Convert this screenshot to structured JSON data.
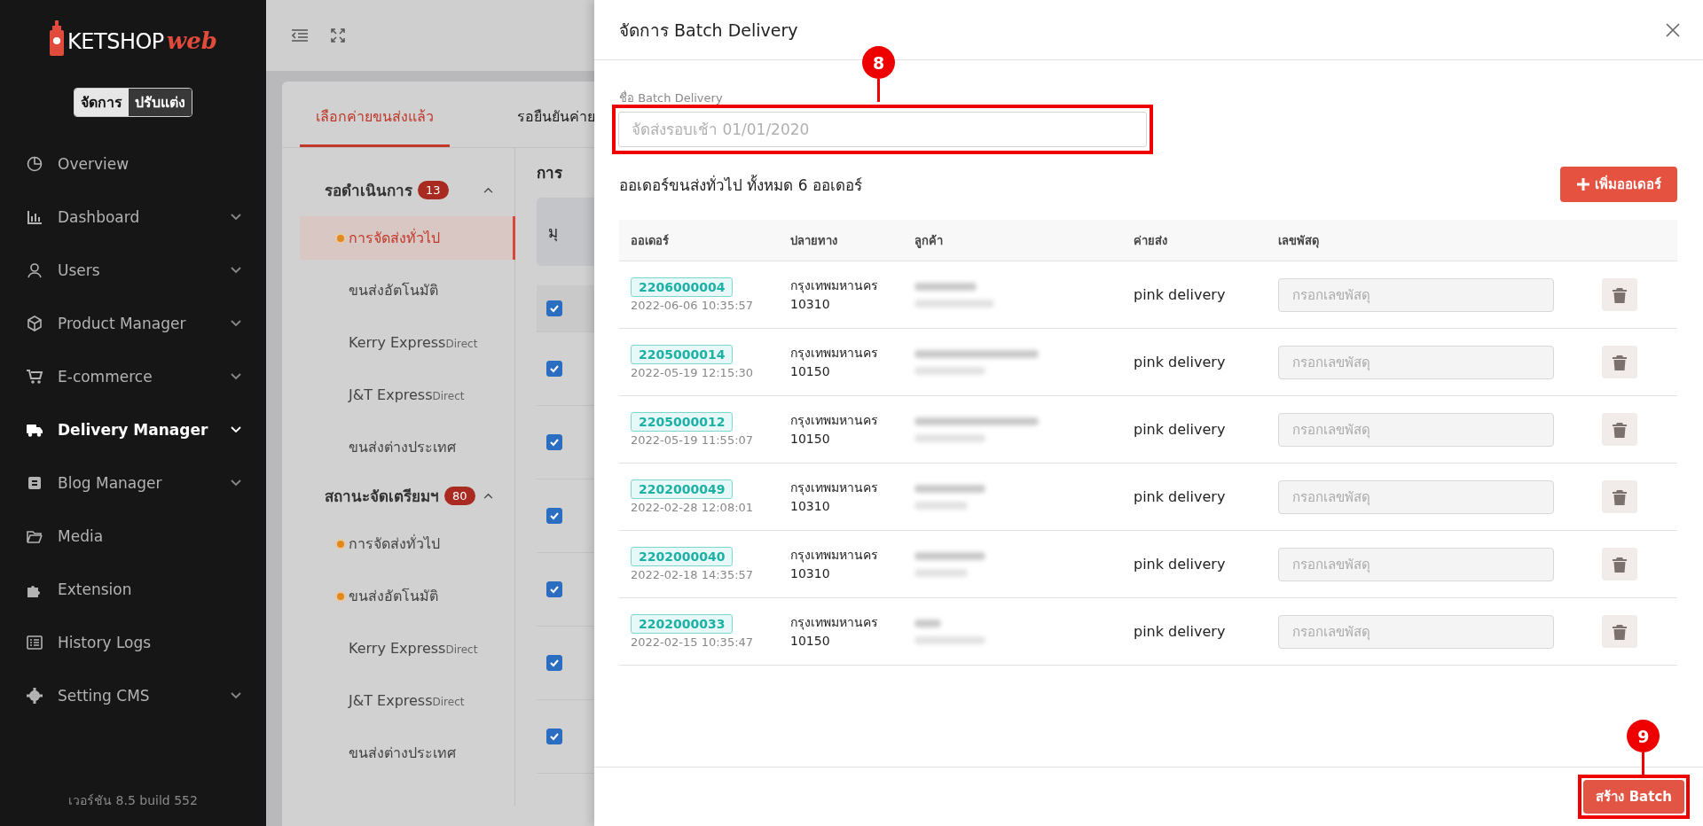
{
  "sidebar": {
    "logo": {
      "main": "KETSHOP",
      "accent": "web"
    },
    "mode_toggle": [
      {
        "label": "จัดการ",
        "selected": true
      },
      {
        "label": "ปรับแต่ง",
        "selected": false
      }
    ],
    "items": [
      {
        "label": "Overview",
        "expandable": false,
        "selected": false
      },
      {
        "label": "Dashboard",
        "expandable": true,
        "selected": false
      },
      {
        "label": "Users",
        "expandable": true,
        "selected": false
      },
      {
        "label": "Product Manager",
        "expandable": true,
        "selected": false
      },
      {
        "label": "E-commerce",
        "expandable": true,
        "selected": false
      },
      {
        "label": "Delivery Manager",
        "expandable": true,
        "selected": true
      },
      {
        "label": "Blog Manager",
        "expandable": true,
        "selected": false
      },
      {
        "label": "Media",
        "expandable": false,
        "selected": false
      },
      {
        "label": "Extension",
        "expandable": false,
        "selected": false
      },
      {
        "label": "History Logs",
        "expandable": false,
        "selected": false
      },
      {
        "label": "Setting CMS",
        "expandable": true,
        "selected": false
      }
    ],
    "version": "เวอร์ชัน 8.5 build 552"
  },
  "main": {
    "tabs": [
      {
        "label": "เลือกค่ายขนส่งแล้ว",
        "selected": true
      },
      {
        "label": "รอยืนยันค่าย",
        "selected": false
      }
    ],
    "groups": [
      {
        "title": "รอดำเนินการ",
        "count": "13",
        "expanded": true,
        "items": [
          {
            "label": "การจัดส่งทั่วไป",
            "dot": true,
            "selected": true
          },
          {
            "label": "ขนส่งอัตโนมัติ",
            "dot": false,
            "selected": false
          },
          {
            "label": "Kerry Express",
            "note": "Direct",
            "dot": false,
            "selected": false
          },
          {
            "label": "J&T Express",
            "note": "Direct",
            "dot": false,
            "selected": false
          },
          {
            "label": "ขนส่งต่างประเทศ",
            "dot": false,
            "selected": false
          }
        ]
      },
      {
        "title": "สถานะจัดเตรียมฯ",
        "count": "80",
        "expanded": true,
        "items": [
          {
            "label": "การจัดส่งทั่วไป",
            "dot": true,
            "selected": false
          },
          {
            "label": "ขนส่งอัตโนมัติ",
            "dot": true,
            "selected": false
          },
          {
            "label": "Kerry Express",
            "note": "Direct",
            "dot": false,
            "selected": false
          },
          {
            "label": "J&T Express",
            "note": "Direct",
            "dot": false,
            "selected": false
          },
          {
            "label": "ขนส่งต่างประเทศ",
            "dot": false,
            "selected": false
          }
        ]
      }
    ],
    "panel": {
      "heading": "การ",
      "filter": "มุ",
      "rows": [
        {
          "checked": true
        },
        {
          "checked": true
        },
        {
          "checked": true
        },
        {
          "checked": true
        },
        {
          "checked": true
        },
        {
          "checked": true
        },
        {
          "checked": true
        }
      ]
    }
  },
  "drawer": {
    "title": "จัดการ Batch Delivery",
    "name_field": {
      "label": "ชื่อ Batch Delivery",
      "placeholder": "จัดส่งรอบเช้า 01/01/2020"
    },
    "summary": "ออเดอร์ขนส่งทั่วไป ทั้งหมด 6 ออเดอร์",
    "add_button": "เพิ่มออเดอร์",
    "table": {
      "columns": [
        "ออเดอร์",
        "ปลายทาง",
        "ลูกค้า",
        "ค่ายส่ง",
        "เลขพัสดุ"
      ],
      "rows": [
        {
          "order": "2206000004",
          "date": "2022-06-06 10:35:57",
          "province": "กรุงเทพมหานคร",
          "postcode": "10310",
          "carrier": "pink delivery",
          "tracking_placeholder": "กรอกเลขพัสดุ"
        },
        {
          "order": "2205000014",
          "date": "2022-05-19 12:15:30",
          "province": "กรุงเทพมหานคร",
          "postcode": "10150",
          "carrier": "pink delivery",
          "tracking_placeholder": "กรอกเลขพัสดุ"
        },
        {
          "order": "2205000012",
          "date": "2022-05-19 11:55:07",
          "province": "กรุงเทพมหานคร",
          "postcode": "10150",
          "carrier": "pink delivery",
          "tracking_placeholder": "กรอกเลขพัสดุ"
        },
        {
          "order": "2202000049",
          "date": "2022-02-28 12:08:01",
          "province": "กรุงเทพมหานคร",
          "postcode": "10310",
          "carrier": "pink delivery",
          "tracking_placeholder": "กรอกเลขพัสดุ"
        },
        {
          "order": "2202000040",
          "date": "2022-02-18 14:35:57",
          "province": "กรุงเทพมหานคร",
          "postcode": "10310",
          "carrier": "pink delivery",
          "tracking_placeholder": "กรอกเลขพัสดุ"
        },
        {
          "order": "2202000033",
          "date": "2022-02-15 10:35:47",
          "province": "กรุงเทพมหานคร",
          "postcode": "10150",
          "carrier": "pink delivery",
          "tracking_placeholder": "กรอกเลขพัสดุ"
        }
      ]
    },
    "submit_button": "สร้าง Batch",
    "callouts": [
      {
        "number": "8"
      },
      {
        "number": "9"
      }
    ]
  }
}
